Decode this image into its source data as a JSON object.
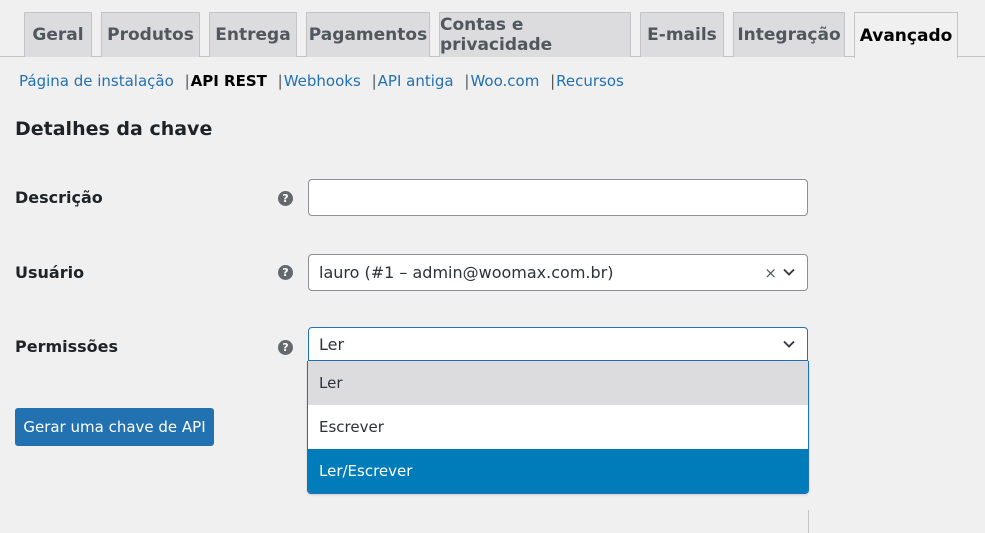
{
  "tabs": [
    {
      "label": "Geral"
    },
    {
      "label": "Produtos"
    },
    {
      "label": "Entrega"
    },
    {
      "label": "Pagamentos"
    },
    {
      "label": "Contas e privacidade"
    },
    {
      "label": "E-mails"
    },
    {
      "label": "Integração"
    },
    {
      "label": "Avançado",
      "active": true
    }
  ],
  "subnav": [
    {
      "label": "Página de instalação"
    },
    {
      "label": "API REST",
      "current": true
    },
    {
      "label": "Webhooks"
    },
    {
      "label": "API antiga"
    },
    {
      "label": "Woo.com"
    },
    {
      "label": "Recursos"
    }
  ],
  "subnav_separator": "|",
  "section_title": "Detalhes da chave",
  "fields": {
    "description": {
      "label": "Descrição",
      "value": "",
      "help_icon": "?"
    },
    "user": {
      "label": "Usuário",
      "value": "lauro (#1 – admin@woomax.com.br)",
      "clear_icon": "×",
      "help_icon": "?"
    },
    "permissions": {
      "label": "Permissões",
      "value": "Ler",
      "help_icon": "?",
      "options": [
        {
          "label": "Ler",
          "state": "selected"
        },
        {
          "label": "Escrever",
          "state": "normal"
        },
        {
          "label": "Ler/Escrever",
          "state": "highlighted"
        }
      ]
    }
  },
  "generate_button": "Gerar uma chave de API",
  "colors": {
    "link": "#2271b1",
    "primary_button": "#2271b1",
    "highlight": "#007cba",
    "selected_option": "#dcdcde"
  }
}
